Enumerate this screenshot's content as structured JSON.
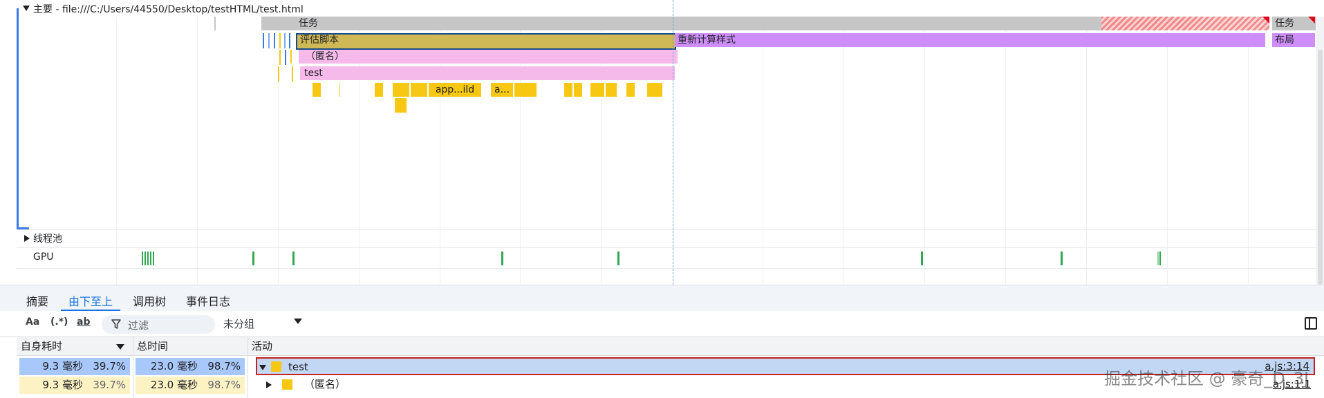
{
  "main_track": {
    "title": "主要 - file:///C:/Users/44550/Desktop/testHTML/test.html",
    "task_label": "任务",
    "task_label_right": "任务",
    "eval_script": "评估脚本",
    "recalc_style": "重新计算样式",
    "layout": "布局",
    "anonymous": "（匿名）",
    "test": "test",
    "fn_build": "app...ild",
    "fn_a": "a..."
  },
  "thread_pool": {
    "label": "线程池"
  },
  "gpu": {
    "label": "GPU"
  },
  "tabs": [
    {
      "label": "摘要"
    },
    {
      "label": "由下至上"
    },
    {
      "label": "调用树"
    },
    {
      "label": "事件日志"
    }
  ],
  "toolbar": {
    "match_case": "Aa",
    "regex": "(.*)",
    "whole_word": "ab",
    "filter_placeholder": "过滤",
    "grouping": "未分组"
  },
  "table": {
    "headers": {
      "self_time": "自身耗时",
      "total_time": "总时间",
      "activity": "活动"
    },
    "rows": [
      {
        "self": "9.3 毫秒",
        "self_pct": "39.7%",
        "total": "23.0 毫秒",
        "total_pct": "98.7%",
        "name": "test",
        "source": "a.js:3:14"
      },
      {
        "self": "9.3 毫秒",
        "self_pct": "39.7%",
        "total": "23.0 毫秒",
        "total_pct": "98.7%",
        "name": "（匿名）",
        "source": "a.js:1:1"
      }
    ]
  },
  "watermark": "掘金技术社区 @ 豪奇_D_3J",
  "colors": {
    "accent": "#1a73e8",
    "script": "#f7c813",
    "recalc": "#cd8ef9",
    "eval": "#cfb956",
    "gpu": "#2fa84f",
    "selected_border": "#c5221f"
  }
}
